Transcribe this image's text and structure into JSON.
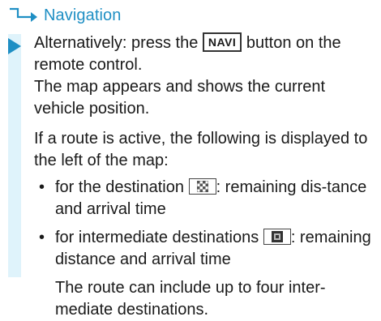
{
  "header": {
    "title": "Navigation"
  },
  "step": {
    "line1_pre": "Alternatively: press the ",
    "key_label": "NAVI",
    "line1_post": " button on the remote control.",
    "line2": "The map appears and shows the current vehicle position.",
    "line3": "If a route is active, the following is displayed to the left of the map:"
  },
  "list": [
    {
      "pre": "for the destination ",
      "icon": "checkered-flag-icon",
      "post": ": remaining dis-tance and arrival time"
    },
    {
      "pre": "for intermediate destinations ",
      "icon": "waypoint-flag-icon",
      "post": ": remaining distance and arrival time"
    }
  ],
  "note": "The route can include up to four inter-mediate destinations.",
  "colors": {
    "accent": "#1f8fc4",
    "panel": "#dff3fb"
  }
}
